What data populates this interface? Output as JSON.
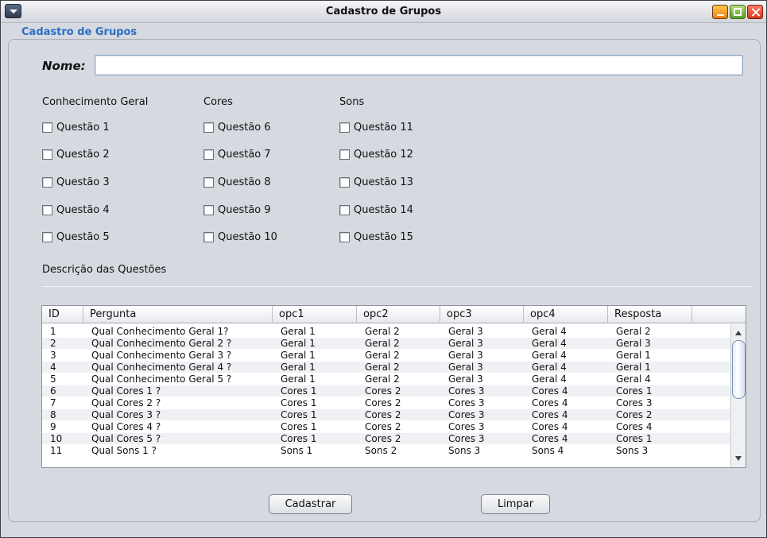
{
  "window": {
    "title": "Cadastro de Grupos",
    "colors": {
      "panel_title": "#2a6fc5",
      "close": "#d23a1a",
      "minimize": "#e87f12",
      "maximize": "#5d9c2a"
    }
  },
  "panel": {
    "title": "Cadastro de Grupos"
  },
  "form": {
    "nome_label": "Nome:",
    "nome_value": ""
  },
  "groups": [
    {
      "heading": "Conhecimento Geral",
      "items": [
        "Questão 1",
        "Questão 2",
        "Questão 3",
        "Questão 4",
        "Questão 5"
      ]
    },
    {
      "heading": "Cores",
      "items": [
        "Questão 6",
        "Questão 7",
        "Questão 8",
        "Questão 9",
        "Questão 10"
      ]
    },
    {
      "heading": "Sons",
      "items": [
        "Questão 11",
        "Questão 12",
        "Questão 13",
        "Questão 14",
        "Questão 15"
      ]
    }
  ],
  "description_label": "Descrição das Questões",
  "table": {
    "columns": [
      "ID",
      "Pergunta",
      "opc1",
      "opc2",
      "opc3",
      "opc4",
      "Resposta"
    ],
    "rows": [
      [
        "1",
        "Qual Conhecimento Geral 1?",
        "Geral 1",
        "Geral 2",
        "Geral 3",
        "Geral 4",
        "Geral 2"
      ],
      [
        "2",
        "Qual Conhecimento Geral 2 ?",
        "Geral 1",
        "Geral 2",
        "Geral 3",
        "Geral 4",
        "Geral 3"
      ],
      [
        "3",
        "Qual Conhecimento Geral 3 ?",
        "Geral 1",
        "Geral 2",
        "Geral 3",
        "Geral 4",
        "Geral 1"
      ],
      [
        "4",
        "Qual Conhecimento Geral 4 ?",
        "Geral 1",
        "Geral 2",
        "Geral 3",
        "Geral 4",
        "Geral 1"
      ],
      [
        "5",
        "Qual Conhecimento Geral 5 ?",
        "Geral 1",
        "Geral 2",
        "Geral 3",
        "Geral 4",
        "Geral 4"
      ],
      [
        "6",
        "Qual Cores 1 ?",
        "Cores 1",
        "Cores 2",
        "Cores 3",
        "Cores 4",
        "Cores 1"
      ],
      [
        "7",
        "Qual Cores 2 ?",
        "Cores 1",
        "Cores 2",
        "Cores 3",
        "Cores 4",
        "Cores 3"
      ],
      [
        "8",
        "Qual Cores 3 ?",
        "Cores 1",
        "Cores 2",
        "Cores 3",
        "Cores 4",
        "Cores 2"
      ],
      [
        "9",
        "Qual Cores 4 ?",
        "Cores 1",
        "Cores 2",
        "Cores 3",
        "Cores 4",
        "Cores 4"
      ],
      [
        "10",
        "Qual Cores 5 ?",
        "Cores 1",
        "Cores 2",
        "Cores 3",
        "Cores 4",
        "Cores 1"
      ],
      [
        "11",
        "Qual Sons 1 ?",
        "Sons 1",
        "Sons 2",
        "Sons 3",
        "Sons 4",
        "Sons 3"
      ]
    ]
  },
  "buttons": {
    "cadastrar": "Cadastrar",
    "limpar": "Limpar"
  }
}
